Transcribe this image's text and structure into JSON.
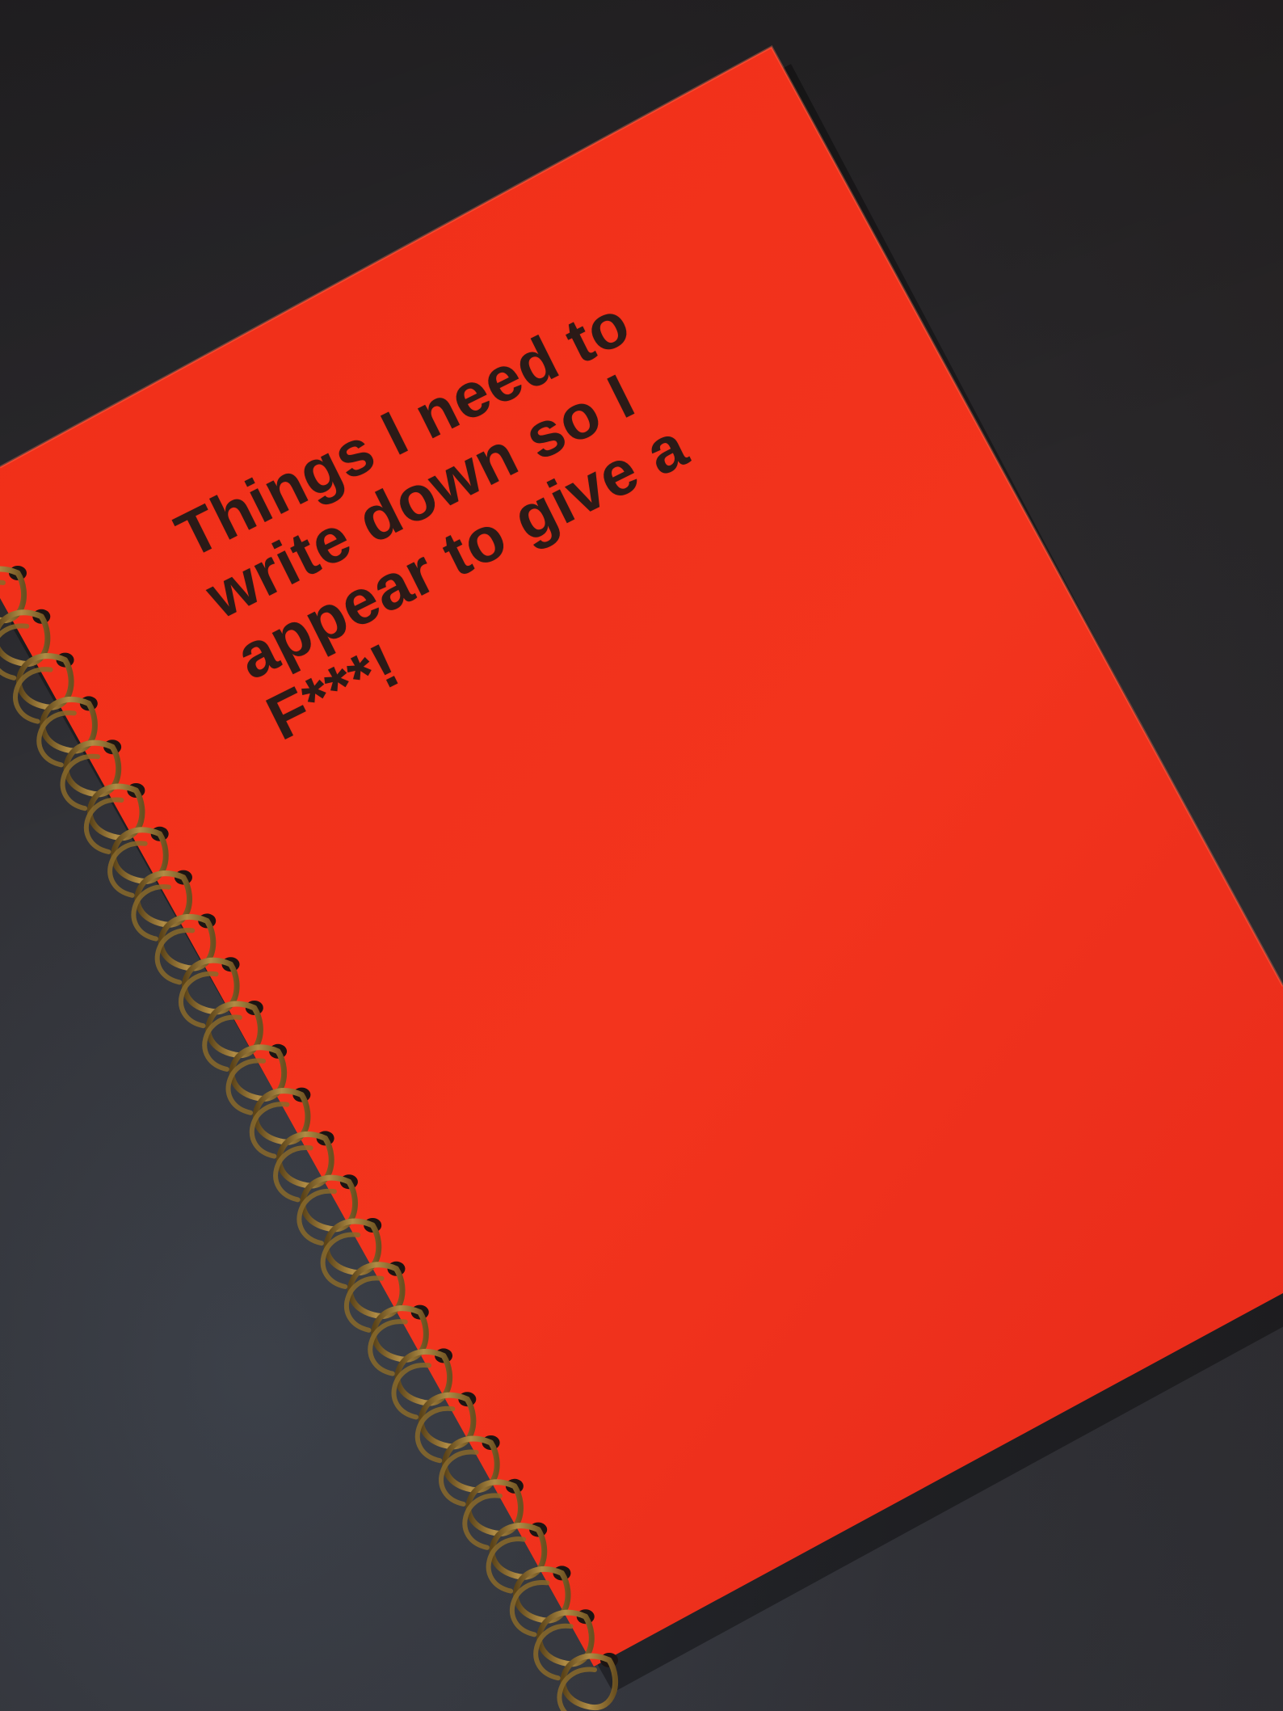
{
  "notebook": {
    "title_lines": [
      "Things I need to",
      "write down so I",
      "appear to give a",
      "F***!"
    ],
    "cover_color": "#f2321c",
    "text_color": "#2b1a17",
    "background_color": "#2a2728",
    "binding_color": "#8a6a2a"
  }
}
